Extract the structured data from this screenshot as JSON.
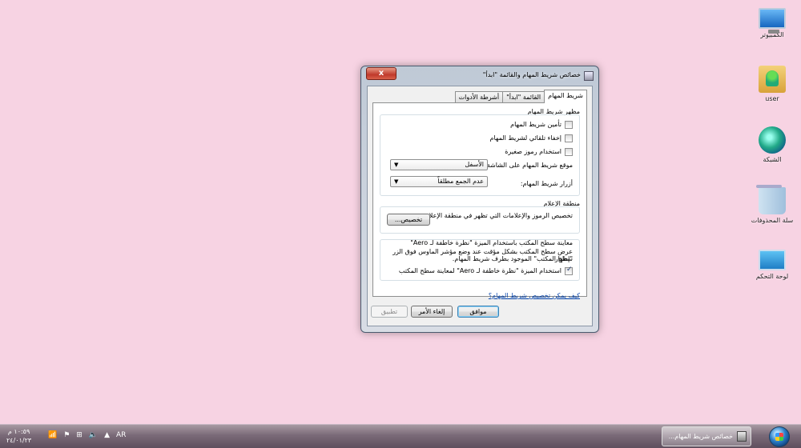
{
  "desktop": {
    "icons": [
      {
        "label": "الكمبيوتر",
        "icon": "computer-icon"
      },
      {
        "label": "user",
        "icon": "user-folder-icon"
      },
      {
        "label": "الشبكة",
        "icon": "network-icon"
      },
      {
        "label": "سلة المحذوفات",
        "icon": "recycle-bin-icon"
      },
      {
        "label": "لوحة التحكم",
        "icon": "control-panel-icon"
      }
    ]
  },
  "dialog": {
    "title": "خصائص شريط المهام والقائمة \"ابدأ\"",
    "close_label": "x",
    "tabs": [
      {
        "label": "شريط المهام",
        "active": true
      },
      {
        "label": "القائمة \"ابدأ\"",
        "active": false
      },
      {
        "label": "أشرطة الأدوات",
        "active": false
      }
    ],
    "appearance": {
      "title": "مظهر شريط المهام",
      "checkboxes": [
        {
          "label": "تأمين شريط المهام",
          "checked": false
        },
        {
          "label": "إخفاء تلقائي لشريط المهام",
          "checked": false
        },
        {
          "label": "استخدام رموز صغيرة",
          "checked": false
        }
      ],
      "location_label": "موقع شريط المهام على الشاشة:",
      "location_value": "الأسفل",
      "buttons_label": "أزرار شريط المهام:",
      "buttons_value": "عدم الجمع مطلقاً"
    },
    "notification": {
      "title": "منطقة الإعلام",
      "description": "تخصيص الرموز والإعلامات التي تظهر في منطقة الإعلام.",
      "customize_label": "تخصيص..."
    },
    "aero_peek": {
      "title": "معاينة سطح المكتب باستخدام الميزة \"نظرة خاطفة لـ Aero\"",
      "description_line1": "عرض سطح المكتب بشكل مؤقت عند وضع مؤشر الماوس فوق الزر \"إظهار",
      "description_line2": "سطح المكتب\" الموجود بطرف شريط المهام.",
      "checkbox_label": "استخدام الميزة \"نظرة خاطفة لـ Aero\" لمعاينة سطح المكتب",
      "checked": true
    },
    "help_link": "كيف يمكن تخصيص شريط المهام؟",
    "ok_label": "موافق",
    "cancel_label": "إلغاء الأمر",
    "apply_label": "تطبيق"
  },
  "taskbar": {
    "task_label": "خصائص شريط المهام...",
    "language": "AR",
    "tray_arrow": "▲",
    "time": "١٠:٥٩ م",
    "date": "٢٤/٠١/٢٣"
  }
}
